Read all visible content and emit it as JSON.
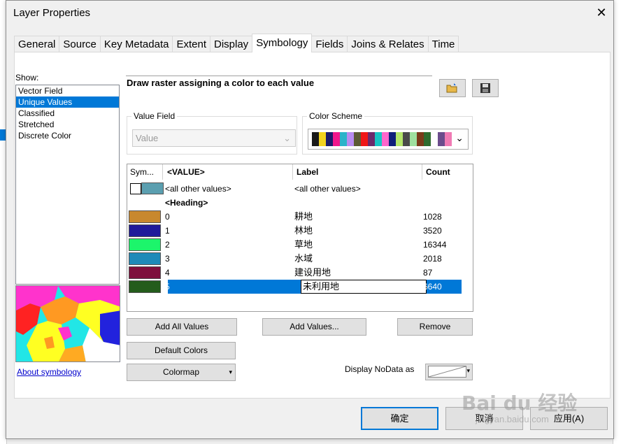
{
  "window": {
    "title": "Layer Properties"
  },
  "tabs": [
    "General",
    "Source",
    "Key Metadata",
    "Extent",
    "Display",
    "Symbology",
    "Fields",
    "Joins & Relates",
    "Time"
  ],
  "active_tab": "Symbology",
  "show": {
    "label": "Show:",
    "items": [
      "Vector Field",
      "Unique Values",
      "Classified",
      "Stretched",
      "Discrete Color"
    ],
    "selected": "Unique Values"
  },
  "about_link": "About symbology",
  "description": "Draw raster assigning a color to each value",
  "value_field": {
    "label": "Value Field",
    "value": "Value"
  },
  "color_scheme": {
    "label": "Color Scheme",
    "colors": [
      "#1a1a1a",
      "#f2d31f",
      "#1b1b6b",
      "#f0168c",
      "#2bb3c9",
      "#b98cf0",
      "#5c5a35",
      "#f01616",
      "#6b2a6b",
      "#17c4c4",
      "#ff66cc",
      "#0f1f7a",
      "#b4e66b",
      "#4a4a4a",
      "#9fe09f",
      "#7a3a1a",
      "#2e6b2e",
      "#ffffff",
      "#6b4c8c",
      "#f07ab4"
    ]
  },
  "table": {
    "headers": {
      "symbol": "Sym...",
      "value": "<VALUE>",
      "label": "Label",
      "count": "Count"
    },
    "other": {
      "value": "<all other values>",
      "label": "<all other values>",
      "color": "#5b9fb0"
    },
    "heading": "<Heading>",
    "rows": [
      {
        "value": "0",
        "label": "耕地",
        "count": "1028",
        "color": "#c8882e"
      },
      {
        "value": "1",
        "label": "林地",
        "count": "3520",
        "color": "#1f1a9a"
      },
      {
        "value": "2",
        "label": "草地",
        "count": "16344",
        "color": "#1cf56b"
      },
      {
        "value": "3",
        "label": "水域",
        "count": "2018",
        "color": "#1e8ab8"
      },
      {
        "value": "4",
        "label": "建设用地",
        "count": "87",
        "color": "#7e0f3c"
      },
      {
        "value": "5",
        "label": "未利用地",
        "count": "6640",
        "color": "#245c1c"
      }
    ],
    "selected_value": "5"
  },
  "buttons": {
    "add_all_values": "Add All Values",
    "add_values": "Add Values...",
    "remove": "Remove",
    "default_colors": "Default Colors",
    "colormap": "Colormap"
  },
  "display_nodata": "Display NoData as",
  "footer": {
    "ok": "确定",
    "cancel": "取消",
    "apply": "应用(A)"
  },
  "watermark": {
    "main": "Bai du 经验",
    "sub": "jingyan.baidu.com"
  }
}
